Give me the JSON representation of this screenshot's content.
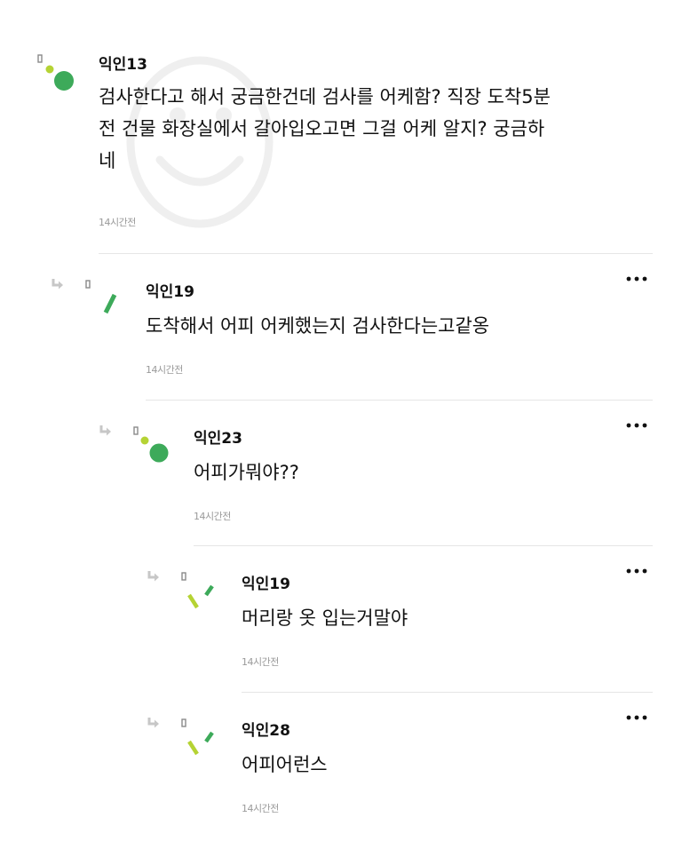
{
  "comments": [
    {
      "author": "익인13",
      "lines": [
        "검사한다고 해서 궁금한건데 검사를 어케함? 직장 도착5분",
        "전 건물 화장실에서 갈아입오고면 그걸 어케 알지? 궁금하",
        "네"
      ],
      "time": "14시간전",
      "avatar_icon": "green-dot-avatar-icon"
    },
    {
      "author": "익인19",
      "lines": [
        "도착해서 어피 어케했는지 검사한다는고같옹"
      ],
      "time": "14시간전",
      "avatar_icon": "green-bar-avatar-icon"
    },
    {
      "author": "익인23",
      "lines": [
        "어피가뭐야??"
      ],
      "time": "14시간전",
      "avatar_icon": "green-dot-avatar-icon"
    },
    {
      "author": "익인19",
      "lines": [
        "머리랑 옷 입는거말야"
      ],
      "time": "14시간전",
      "avatar_icon": "lime-check-avatar-icon"
    },
    {
      "author": "익인28",
      "lines": [
        "어피어런스"
      ],
      "time": "14시간전",
      "avatar_icon": "lime-check-avatar-icon"
    }
  ],
  "colors": {
    "text": "#111111",
    "time": "#9a9a9a",
    "divider": "#e6e6e6",
    "green": "#3daa5a",
    "lime": "#b5d334",
    "reply_arrow": "#c7c7c7"
  }
}
